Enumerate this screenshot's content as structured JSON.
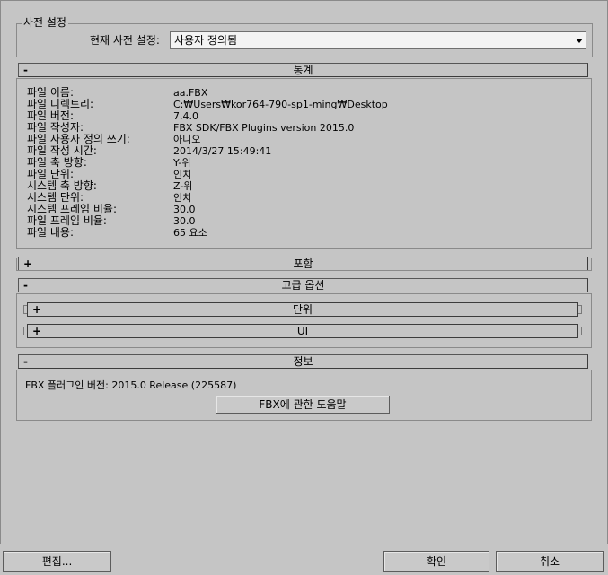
{
  "presets": {
    "group_title": "사전 설정",
    "label": "현재 사전 설정:",
    "selected": "사용자 정의됨"
  },
  "statistics": {
    "header": "통계",
    "sign": "-",
    "rows": [
      {
        "label": "파일 이름:",
        "value": "aa.FBX"
      },
      {
        "label": "파일 디렉토리:",
        "value": "C:₩Users₩kor764-790-sp1-ming₩Desktop"
      },
      {
        "label": "파일 버전:",
        "value": "7.4.0"
      },
      {
        "label": "파일 작성자:",
        "value": "FBX SDK/FBX Plugins version 2015.0"
      },
      {
        "label": "파일 사용자 정의 쓰기:",
        "value": "아니오"
      },
      {
        "label": "파일 작성 시간:",
        "value": "2014/3/27  15:49:41"
      },
      {
        "label": "파일 축 방향:",
        "value": "Y-위"
      },
      {
        "label": "파일 단위:",
        "value": "인치"
      },
      {
        "label": "시스템 축 방향:",
        "value": "Z-위"
      },
      {
        "label": "시스템 단위:",
        "value": "인치"
      },
      {
        "label": "시스템 프레임 비율:",
        "value": "30.0"
      },
      {
        "label": "파일 프레임 비율:",
        "value": "30.0"
      },
      {
        "label": "파일 내용:",
        "value": "65 요소"
      }
    ]
  },
  "include": {
    "header": "포함",
    "sign": "+"
  },
  "advanced": {
    "header": "고급 옵션",
    "sign": "-",
    "subs": [
      {
        "header": "단위",
        "sign": "+"
      },
      {
        "header": "UI",
        "sign": "+"
      }
    ]
  },
  "info": {
    "header": "정보",
    "sign": "-",
    "plugin_version": "FBX 플러그인 버전: 2015.0 Release (225587)",
    "help_button": "FBX에 관한 도움말"
  },
  "footer": {
    "edit_button": "편집...",
    "ok_button": "확인",
    "cancel_button": "취소"
  }
}
